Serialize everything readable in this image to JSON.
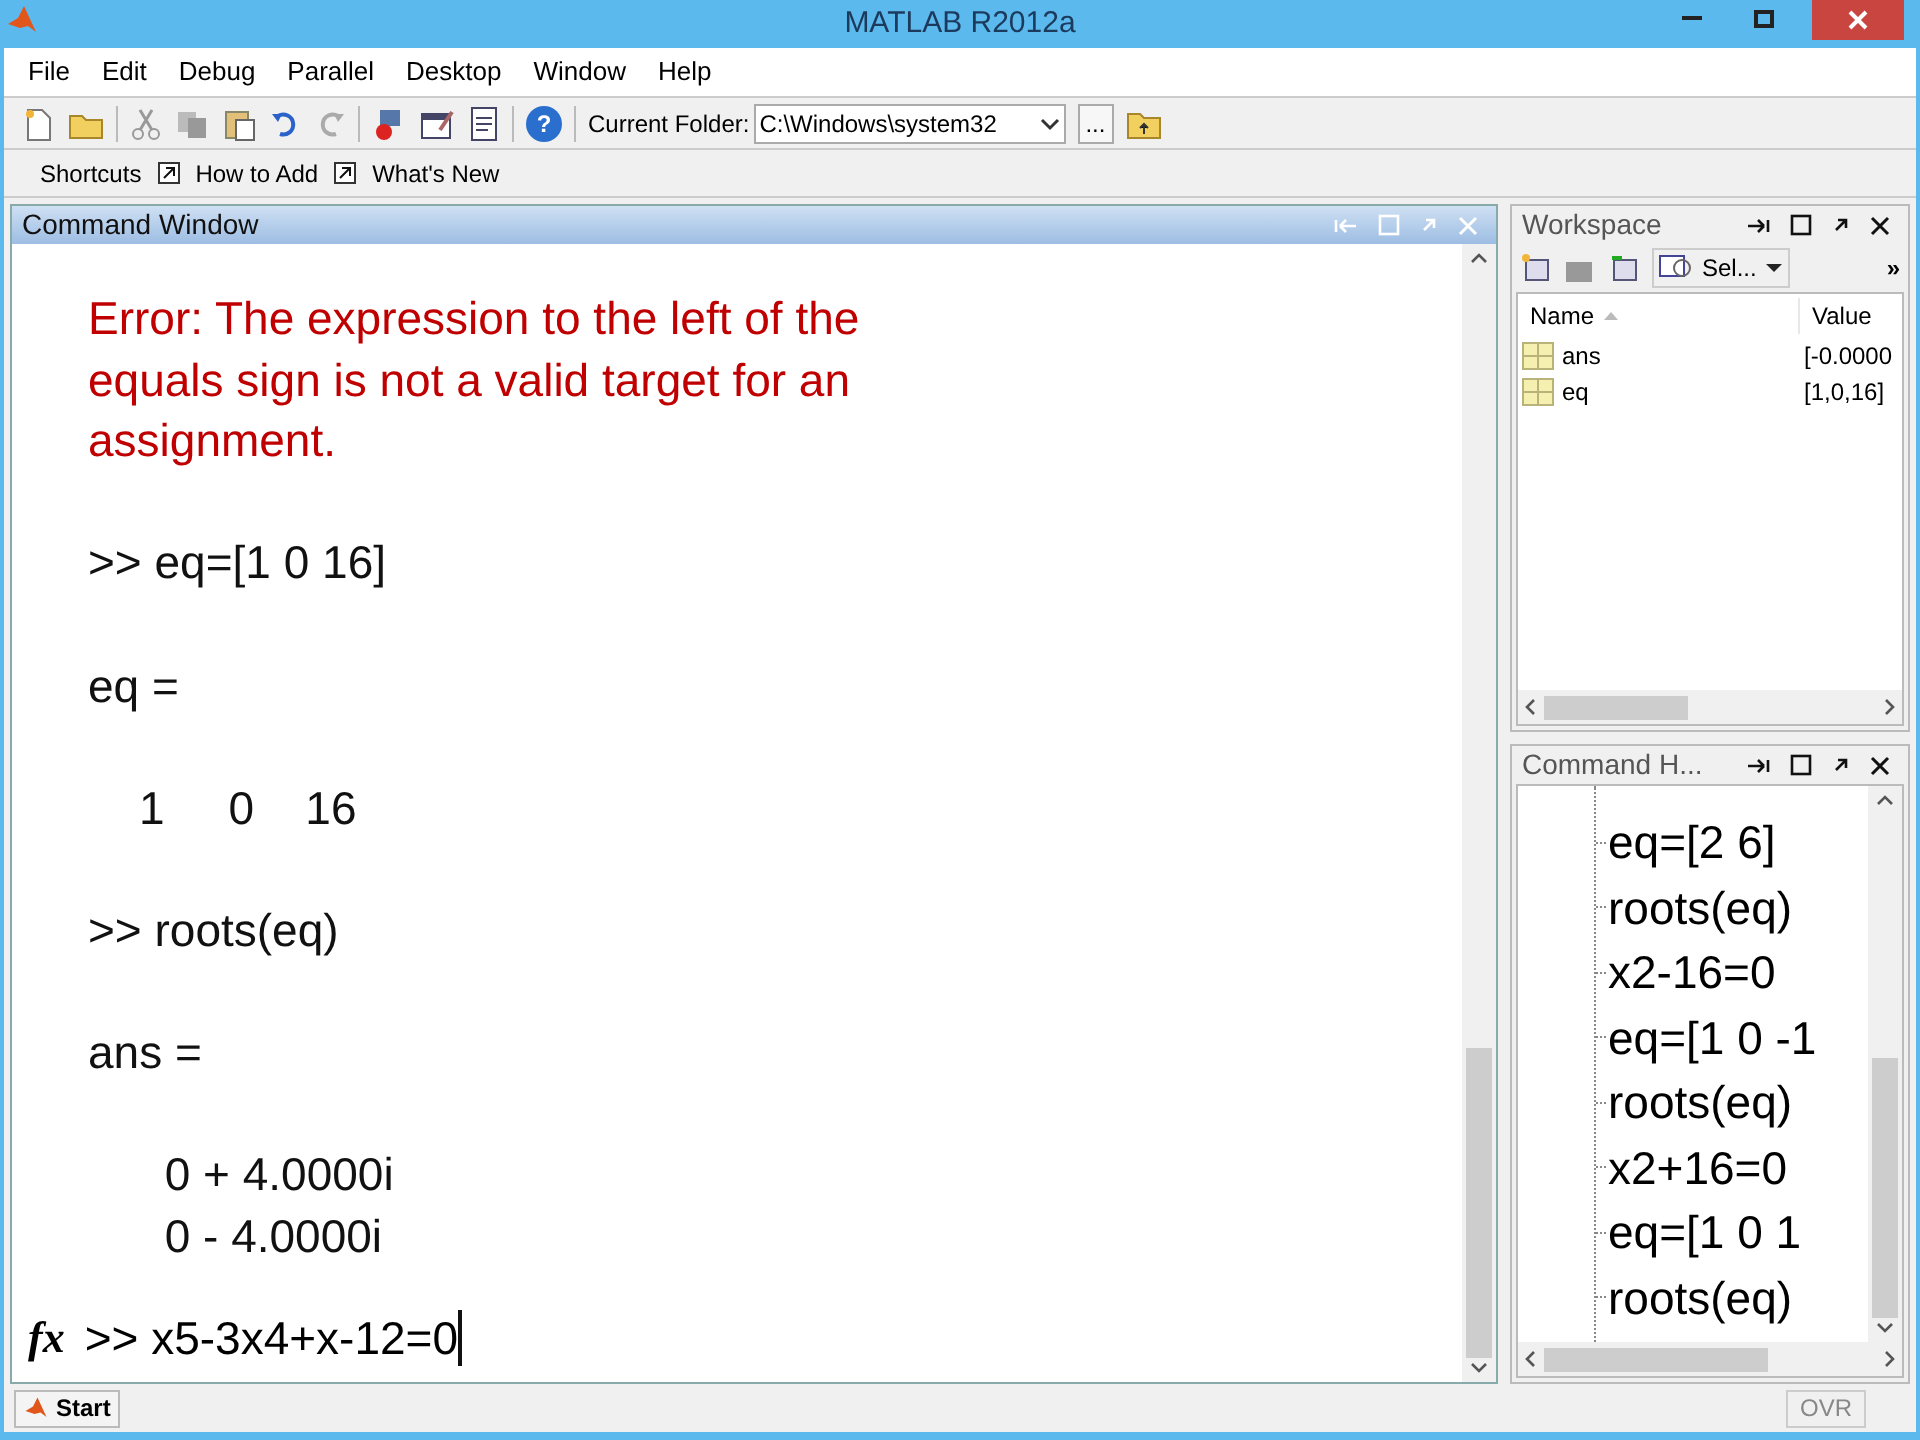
{
  "window": {
    "title": "MATLAB  R2012a"
  },
  "menu": [
    "File",
    "Edit",
    "Debug",
    "Parallel",
    "Desktop",
    "Window",
    "Help"
  ],
  "toolbar": {
    "folder_label": "Current Folder:",
    "folder_value": "C:\\Windows\\system32",
    "browse": "...",
    "help": "?"
  },
  "shortcuts": [
    "Shortcuts",
    "How to Add",
    "What's New"
  ],
  "command_window": {
    "title": "Command Window",
    "lines": [
      {
        "kind": "error",
        "text": "Error: The expression to the left of the"
      },
      {
        "kind": "error",
        "text": "equals sign is not a valid target for an"
      },
      {
        "kind": "error",
        "text": "assignment."
      },
      {
        "kind": "blank"
      },
      {
        "kind": "input",
        "text": ">> eq=[1 0 16]"
      },
      {
        "kind": "blank"
      },
      {
        "kind": "output",
        "text": "eq ="
      },
      {
        "kind": "blank"
      },
      {
        "kind": "output",
        "text": "    1     0    16"
      },
      {
        "kind": "blank"
      },
      {
        "kind": "input",
        "text": ">> roots(eq)"
      },
      {
        "kind": "blank"
      },
      {
        "kind": "output",
        "text": "ans ="
      },
      {
        "kind": "blank"
      },
      {
        "kind": "output",
        "text": "      0 + 4.0000i"
      },
      {
        "kind": "output",
        "text": "      0 - 4.0000i"
      },
      {
        "kind": "blank"
      }
    ],
    "prompt": ">> x5-3x4+x-12=0",
    "fx": "fx"
  },
  "workspace": {
    "title": "Workspace",
    "select": "Sel...",
    "overflow": "»",
    "columns": [
      "Name",
      "Value"
    ],
    "rows": [
      {
        "name": "ans",
        "value": "[-0.0000"
      },
      {
        "name": "eq",
        "value": "[1,0,16]"
      }
    ]
  },
  "history": {
    "title": "Command H...",
    "items": [
      "eq=[2 6]",
      "roots(eq)",
      "x2-16=0",
      "eq=[1 0 -1",
      "roots(eq)",
      "x2+16=0",
      "eq=[1 0 1",
      "roots(eq)"
    ]
  },
  "status_bar": {
    "start": "Start",
    "ovr": "OVR"
  }
}
